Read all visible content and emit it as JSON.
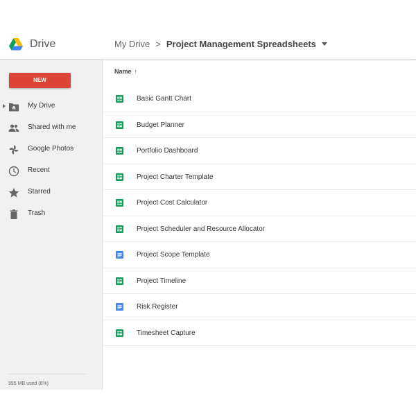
{
  "header": {
    "brand": "Drive",
    "breadcrumb_root": "My Drive",
    "breadcrumb_separator": ">",
    "breadcrumb_current": "Project Management Spreadsheets"
  },
  "sidebar": {
    "new_label": "NEW",
    "items": [
      {
        "label": "My Drive",
        "icon": "drive-folder-icon"
      },
      {
        "label": "Shared with me",
        "icon": "people-icon"
      },
      {
        "label": "Google Photos",
        "icon": "photos-pinwheel-icon"
      },
      {
        "label": "Recent",
        "icon": "clock-icon"
      },
      {
        "label": "Starred",
        "icon": "star-icon"
      },
      {
        "label": "Trash",
        "icon": "trash-icon"
      }
    ],
    "storage": "995 MB used (6%)"
  },
  "list": {
    "column_name": "Name",
    "sort_indicator": "↑",
    "files": [
      {
        "name": "Basic Gantt Chart",
        "type": "sheet"
      },
      {
        "name": "Budget Planner",
        "type": "sheet"
      },
      {
        "name": "Portfolio Dashboard",
        "type": "sheet"
      },
      {
        "name": "Project Charter Template",
        "type": "sheet"
      },
      {
        "name": "Project Cost Calculator",
        "type": "sheet"
      },
      {
        "name": "Project Scheduler and Resource Allocator",
        "type": "sheet"
      },
      {
        "name": "Project Scope Template",
        "type": "doc"
      },
      {
        "name": "Project Timeline",
        "type": "sheet"
      },
      {
        "name": "Risk Register",
        "type": "doc"
      },
      {
        "name": "Timesheet Capture",
        "type": "sheet"
      }
    ]
  },
  "colors": {
    "new_button": "#db4437",
    "sheet_icon": "#0f9d58",
    "doc_icon": "#4285f4",
    "sidebar_bg": "#f1f1f1"
  }
}
